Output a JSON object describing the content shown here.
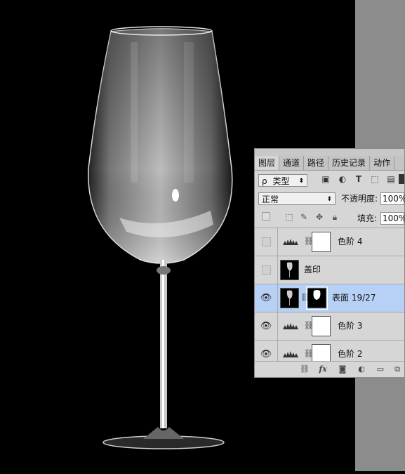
{
  "panel": {
    "tabs": [
      {
        "label": "图层",
        "active": true
      },
      {
        "label": "通道",
        "active": false
      },
      {
        "label": "路径",
        "active": false
      },
      {
        "label": "历史记录",
        "active": false
      },
      {
        "label": "动作",
        "active": false
      }
    ],
    "filter": {
      "kind_label": "类型",
      "search_glyph": "ρ"
    },
    "blend": {
      "mode": "正常",
      "opacity_label": "不透明度:",
      "opacity_value": "100%"
    },
    "lock": {
      "fill_label": "填充:",
      "fill_value": "100%"
    },
    "layers": [
      {
        "name": "色阶 4",
        "type": "adjustment",
        "visible": false,
        "selected": false
      },
      {
        "name": "盖印",
        "type": "pixel",
        "visible": false,
        "selected": false
      },
      {
        "name": "表面 19/27",
        "type": "masked",
        "visible": true,
        "selected": true
      },
      {
        "name": "色阶 3",
        "type": "adjustment",
        "visible": true,
        "selected": false
      },
      {
        "name": "色阶 2",
        "type": "adjustment",
        "visible": true,
        "selected": false
      }
    ],
    "footer_icons": [
      "link-icon",
      "fx-icon",
      "mask-icon",
      "adjustment-icon",
      "folder-icon",
      "new-layer-icon"
    ],
    "footer_fx_label": "fx",
    "colors": {
      "panel_bg": "#d6d6d6",
      "selected_row": "#b7d0f5",
      "canvas_bg": "#000000",
      "gutter": "#8c8c8c"
    }
  }
}
